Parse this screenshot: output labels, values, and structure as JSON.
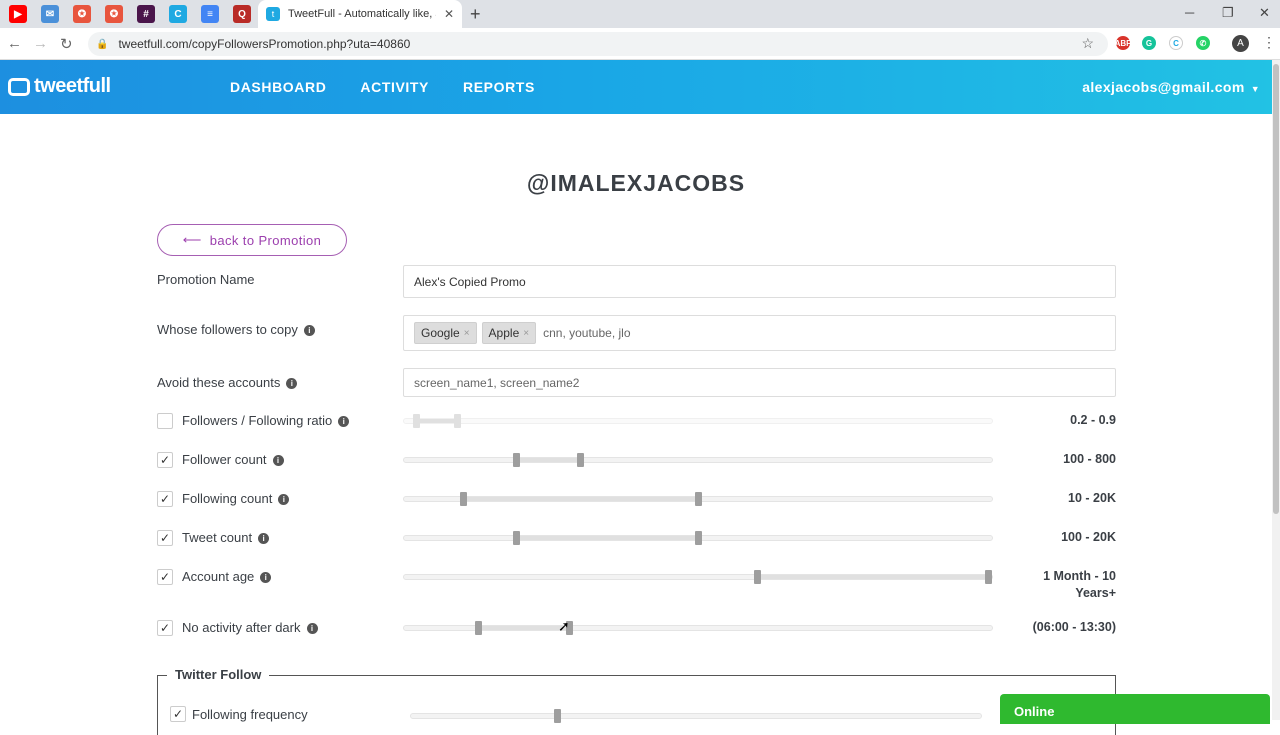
{
  "browser": {
    "pinned_tabs": [
      {
        "name": "youtube-tab",
        "glyph": "▶",
        "color": "#ff0000"
      },
      {
        "name": "mail-tab",
        "glyph": "✉",
        "color": "#4a90d9"
      },
      {
        "name": "app-tab-1",
        "glyph": "✪",
        "color": "#e8553e"
      },
      {
        "name": "app-tab-2",
        "glyph": "✪",
        "color": "#e8553e"
      },
      {
        "name": "slack-tab",
        "glyph": "#",
        "color": "#4a154b"
      },
      {
        "name": "app-tab-3",
        "glyph": "C",
        "color": "#1fa9e2"
      },
      {
        "name": "docs-tab",
        "glyph": "≡",
        "color": "#4285f4"
      },
      {
        "name": "quora-tab",
        "glyph": "Q",
        "color": "#b92b27"
      }
    ],
    "active_tab_title": "TweetFull - Automatically like, au",
    "url": "tweetfull.com/copyFollowersPromotion.php?uta=40860",
    "profile_initial": "A"
  },
  "header": {
    "logo_text": "tweetfull",
    "nav": [
      "DASHBOARD",
      "ACTIVITY",
      "REPORTS"
    ],
    "user_email": "alexjacobs@gmail.com"
  },
  "page": {
    "title": "@IMALEXJACOBS",
    "back_label": "back to Promotion",
    "promotion_name_label": "Promotion Name",
    "promotion_name_value": "Alex's Copied Promo",
    "whose_followers_label": "Whose followers to copy",
    "whose_followers_tags": [
      "Google",
      "Apple"
    ],
    "whose_followers_placeholder": "cnn, youtube, jlo",
    "avoid_label": "Avoid these accounts",
    "avoid_placeholder": "screen_name1, screen_name2"
  },
  "filters": [
    {
      "label": "Followers / Following ratio",
      "checked": false,
      "value_text": "0.2 - 0.9",
      "low": 0.02,
      "high": 0.09
    },
    {
      "label": "Follower count",
      "checked": true,
      "value_text": "100 - 800",
      "low": 0.19,
      "high": 0.3
    },
    {
      "label": "Following count",
      "checked": true,
      "value_text": "10 - 20K",
      "low": 0.1,
      "high": 0.5
    },
    {
      "label": "Tweet count",
      "checked": true,
      "value_text": "100 - 20K",
      "low": 0.19,
      "high": 0.5
    },
    {
      "label": "Account age",
      "checked": true,
      "value_text": "1 Month - 10 Years+",
      "low": 0.6,
      "high": 1.0
    },
    {
      "label": "No activity after dark",
      "checked": true,
      "value_text": "(06:00 - 13:30)",
      "low": 0.125,
      "high": 0.28
    }
  ],
  "twitter_follow": {
    "legend": "Twitter Follow",
    "frequency_label": "Following frequency",
    "frequency_level": 0.25
  },
  "status": {
    "online_label": "Online"
  },
  "colors": {
    "header_start": "#1d8fe0",
    "header_end": "#22c2e4",
    "accent_purple": "#9c3fae",
    "online_green": "#2fb92f"
  }
}
